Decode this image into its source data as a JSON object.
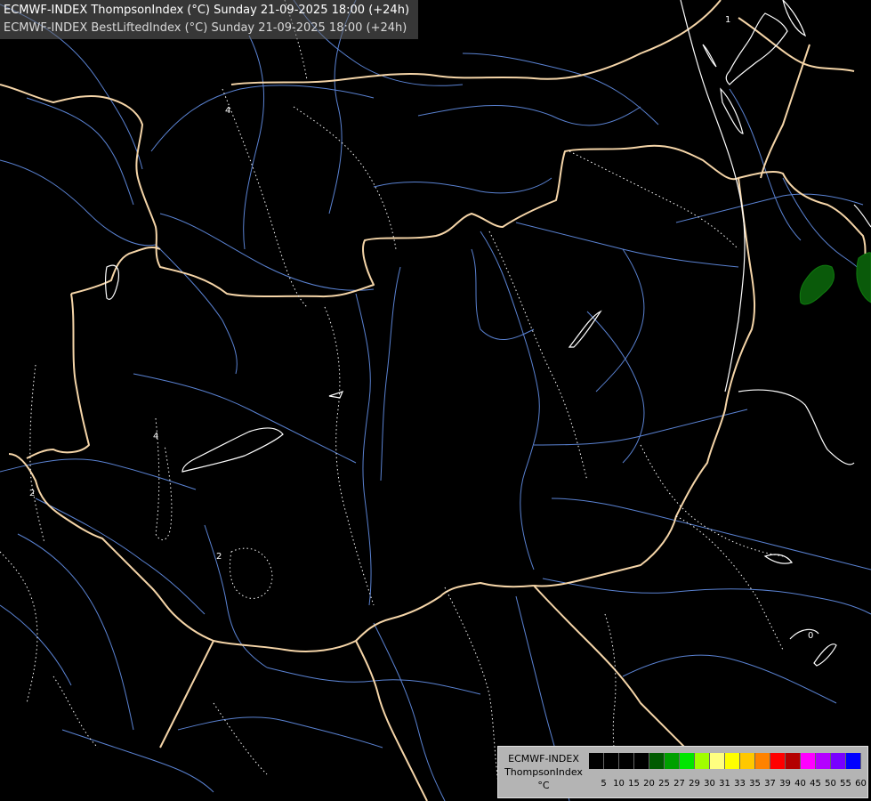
{
  "header": {
    "line1": "ECMWF-INDEX ThompsonIndex (°C) Sunday 21-09-2025 18:00 (+24h)",
    "line2": "ECMWF-INDEX BestLiftedIndex (°C) Sunday 21-09-2025 18:00 (+24h)"
  },
  "legend": {
    "title1": "ECMWF-INDEX",
    "title2": "ThompsonIndex",
    "unit": "°C",
    "bins": [
      {
        "label": "5",
        "color": "#000000"
      },
      {
        "label": "10",
        "color": "#000000"
      },
      {
        "label": "15",
        "color": "#000000"
      },
      {
        "label": "20",
        "color": "#000000"
      },
      {
        "label": "25",
        "color": "#005a00"
      },
      {
        "label": "27",
        "color": "#00a000"
      },
      {
        "label": "29",
        "color": "#00e600"
      },
      {
        "label": "30",
        "color": "#a0ff00"
      },
      {
        "label": "31",
        "color": "#ffff80"
      },
      {
        "label": "33",
        "color": "#ffff00"
      },
      {
        "label": "35",
        "color": "#ffc800"
      },
      {
        "label": "37",
        "color": "#ff8200"
      },
      {
        "label": "39",
        "color": "#ff0000"
      },
      {
        "label": "40",
        "color": "#b40000"
      },
      {
        "label": "45",
        "color": "#ff00ff"
      },
      {
        "label": "50",
        "color": "#b400ff"
      },
      {
        "label": "55",
        "color": "#7800ff"
      },
      {
        "label": "60",
        "color": "#0000ff"
      }
    ]
  },
  "map": {
    "contour_labels": [
      "4",
      "4",
      "2",
      "2",
      "0",
      "1"
    ],
    "colors": {
      "background": "#000000",
      "border": "#f5d5a8",
      "river": "#5a82d2",
      "contour": "#ffffff",
      "lifted_index": "#ffffff",
      "thompson_fill": "#0a5a0a"
    }
  }
}
